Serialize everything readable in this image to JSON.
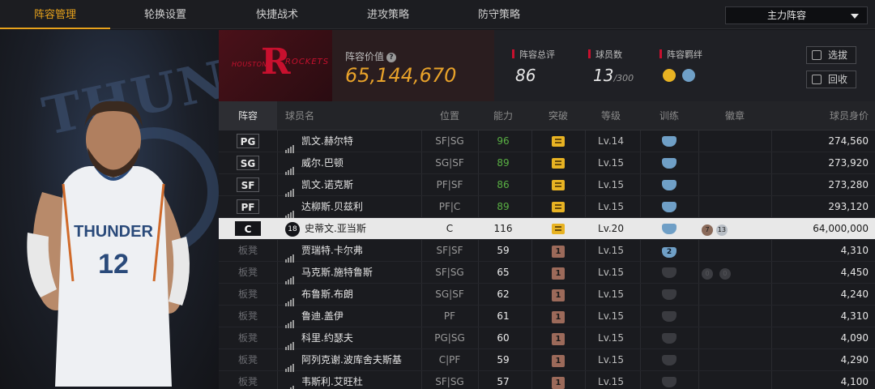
{
  "tabs": [
    "阵容管理",
    "轮换设置",
    "快捷战术",
    "进攻策略",
    "防守策略"
  ],
  "active_tab": 0,
  "lineup_select": {
    "value": "主力阵容"
  },
  "team": {
    "banner_text_left": "HOUSTON",
    "banner_text_right": "ROCKETS",
    "value_label": "阵容价值",
    "value": "65,144,670",
    "rating_label": "阵容总评",
    "rating": "86",
    "players_label": "球员数",
    "players": "13",
    "players_max": "/300",
    "bond_label": "阵容羁绊"
  },
  "buttons": {
    "select": "选拔",
    "release": "回收"
  },
  "columns": [
    "阵容",
    "球员名",
    "位置",
    "能力",
    "突破",
    "等级",
    "训练",
    "徽章",
    "球员身价"
  ],
  "rows": [
    {
      "slot": "PG",
      "starter": true,
      "name": "凯文.赫尔特",
      "pos": "SF|SG",
      "ability": "96",
      "green": true,
      "breakthrough": "crown",
      "level": "Lv.14",
      "training": "shield",
      "train_num": "",
      "value": "274,560"
    },
    {
      "slot": "SG",
      "starter": true,
      "name": "威尔.巴顿",
      "pos": "SG|SF",
      "ability": "89",
      "green": true,
      "breakthrough": "crown",
      "level": "Lv.15",
      "training": "shield",
      "train_num": "",
      "value": "273,920"
    },
    {
      "slot": "SF",
      "starter": true,
      "name": "凯文.诺克斯",
      "pos": "PF|SF",
      "ability": "86",
      "green": true,
      "breakthrough": "crown",
      "level": "Lv.15",
      "training": "shield",
      "train_num": "",
      "value": "273,280"
    },
    {
      "slot": "PF",
      "starter": true,
      "name": "达柳斯.贝兹利",
      "pos": "PF|C",
      "ability": "89",
      "green": true,
      "breakthrough": "crown",
      "level": "Lv.15",
      "training": "shield",
      "train_num": "",
      "value": "293,120"
    },
    {
      "slot": "C",
      "starter": true,
      "selected": true,
      "jersey": "18",
      "name": "史蒂文.亚当斯",
      "pos": "C",
      "ability": "116",
      "green": false,
      "breakthrough": "crown",
      "level": "Lv.20",
      "training": "shield",
      "train_num": "",
      "badge1": "7",
      "badge2": "13",
      "value": "64,000,000"
    },
    {
      "slot": "板凳",
      "name": "贾瑞特.卡尔弗",
      "pos": "SF|SF",
      "ability": "59",
      "breakthrough": "1",
      "level": "Lv.15",
      "training": "shield",
      "train_num": "2",
      "value": "4,310"
    },
    {
      "slot": "板凳",
      "name": "马克斯.施特鲁斯",
      "pos": "SF|SG",
      "ability": "65",
      "breakthrough": "1",
      "level": "Lv.15",
      "training": "dim",
      "train_num": "",
      "badge1": "0",
      "badge2": "0",
      "value": "4,450"
    },
    {
      "slot": "板凳",
      "name": "布鲁斯.布朗",
      "pos": "SG|SF",
      "ability": "62",
      "breakthrough": "1",
      "level": "Lv.15",
      "training": "dim",
      "train_num": "",
      "value": "4,240"
    },
    {
      "slot": "板凳",
      "name": "鲁迪.盖伊",
      "pos": "PF",
      "ability": "61",
      "breakthrough": "1",
      "level": "Lv.15",
      "training": "dim",
      "train_num": "",
      "value": "4,310"
    },
    {
      "slot": "板凳",
      "name": "科里.约瑟夫",
      "pos": "PG|SG",
      "ability": "60",
      "breakthrough": "1",
      "level": "Lv.15",
      "training": "dim",
      "train_num": "",
      "value": "4,090"
    },
    {
      "slot": "板凳",
      "name": "阿列克谢.波库舍夫斯基",
      "pos": "C|PF",
      "ability": "59",
      "breakthrough": "1",
      "level": "Lv.15",
      "training": "dim",
      "train_num": "",
      "value": "4,290"
    },
    {
      "slot": "板凳",
      "name": "韦斯利.艾旺杜",
      "pos": "SF|SG",
      "ability": "57",
      "breakthrough": "1",
      "level": "Lv.15",
      "training": "dim",
      "train_num": "",
      "value": "4,100"
    }
  ],
  "art": {
    "jersey_team": "THUNDER",
    "jersey_number": "12",
    "wordmark": "THUNDER"
  },
  "colors": {
    "accent": "#e7a21c",
    "value_gold": "#e8a22a",
    "rocket_red": "#c8102e",
    "ability_green": "#59b043"
  }
}
